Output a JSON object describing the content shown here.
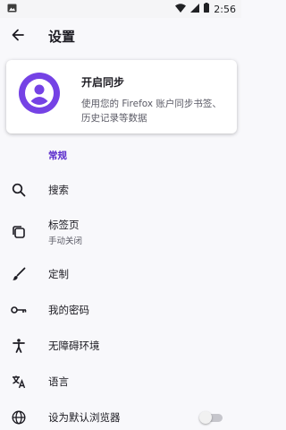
{
  "status_bar": {
    "time": "2:56",
    "notification_icon": "image-icon",
    "wifi_icon": "wifi-icon",
    "signal_icon": "cell-signal-icon",
    "battery_icon": "battery-icon"
  },
  "app_bar": {
    "back_icon": "arrow-back-icon",
    "title": "设置"
  },
  "sync_card": {
    "title": "开启同步",
    "description": "使用您的 Firefox 账户同步书签、历史记录等数据"
  },
  "section": {
    "general_header": "常规"
  },
  "items": [
    {
      "label": "搜索",
      "icon": "search-icon"
    },
    {
      "label": "标签页",
      "sublabel": "手动关闭",
      "icon": "tabs-icon"
    },
    {
      "label": "定制",
      "icon": "brush-icon"
    },
    {
      "label": "我的密码",
      "icon": "key-icon"
    },
    {
      "label": "无障碍环境",
      "icon": "accessibility-icon"
    },
    {
      "label": "语言",
      "icon": "translate-icon"
    },
    {
      "label": "设为默认浏览器",
      "icon": "globe-icon",
      "toggle_on": false
    }
  ],
  "colors": {
    "accent": "#592acb",
    "avatar": "#7542e5",
    "text": "#1c1b22",
    "secondary_text": "#5b5b66"
  }
}
